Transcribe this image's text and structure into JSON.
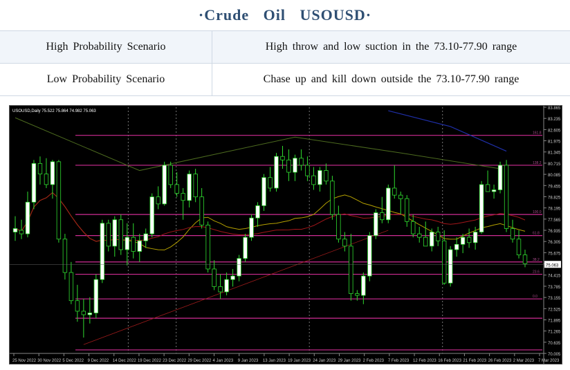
{
  "header": {
    "title": "·Crude Oil USOUSD·"
  },
  "scenarios": [
    {
      "label": "High Probability Scenario",
      "value": "High throw and low suction in the 73.10-77.90 range"
    },
    {
      "label": "Low Probability Scenario",
      "value": "Chase up and kill down outside the 73.10-77.90 range"
    }
  ],
  "chart_data": {
    "type": "candlestick",
    "info_line": "USOUSD,Daily 75.522 75.864 74.982 75.063",
    "price_ticks": [
      "83.865",
      "83.235",
      "82.605",
      "81.975",
      "81.345",
      "80.715",
      "80.085",
      "79.455",
      "78.825",
      "78.195",
      "77.565",
      "76.935",
      "76.305",
      "75.675",
      "75.045",
      "74.415",
      "73.785",
      "73.155",
      "72.525",
      "71.895",
      "71.265",
      "70.635",
      "70.005"
    ],
    "date_ticks": [
      "25 Nov 2022",
      "30 Nov 2022",
      "5 Dec 2022",
      "9 Dec 2022",
      "14 Dec 2022",
      "19 Dec 2022",
      "23 Dec 2022",
      "29 Dec 2022",
      "4 Jan 2023",
      "9 Jan 2023",
      "13 Jan 2023",
      "19 Jan 2023",
      "24 Jan 2023",
      "29 Jan 2023",
      "2 Feb 2023",
      "7 Feb 2023",
      "12 Feb 2023",
      "16 Feb 2023",
      "21 Feb 2023",
      "26 Feb 2023",
      "2 Mar 2023",
      "7 Mar 2023"
    ],
    "ylim": [
      70.0,
      84.0
    ],
    "current_price": "75.063",
    "level_labels": [
      "161.8",
      "138.2",
      "100.0",
      "61.8",
      "38.2",
      "23.6",
      "0.0"
    ],
    "levels": [
      82.4,
      80.7,
      77.9,
      76.7,
      75.2,
      74.5,
      73.1,
      72.0,
      70.2
    ],
    "candles": [
      [
        76.9,
        77.8,
        76.4,
        77.1
      ],
      [
        77.0,
        77.6,
        76.5,
        76.8
      ],
      [
        76.8,
        79.2,
        76.6,
        78.6
      ],
      [
        78.6,
        81.0,
        78.2,
        80.8
      ],
      [
        80.8,
        81.2,
        79.6,
        80.2
      ],
      [
        80.2,
        81.1,
        79.4,
        79.6
      ],
      [
        79.6,
        81.0,
        78.8,
        80.9
      ],
      [
        80.9,
        81.0,
        76.3,
        76.5
      ],
      [
        76.5,
        76.8,
        74.2,
        74.6
      ],
      [
        74.6,
        75.2,
        72.8,
        73.0
      ],
      [
        73.0,
        73.9,
        71.8,
        72.4
      ],
      [
        72.4,
        73.1,
        70.9,
        72.2
      ],
      [
        72.2,
        73.2,
        71.7,
        72.3
      ],
      [
        72.3,
        74.5,
        72.0,
        74.2
      ],
      [
        74.2,
        77.6,
        74.0,
        77.4
      ],
      [
        77.4,
        77.6,
        75.8,
        76.1
      ],
      [
        76.1,
        77.8,
        75.5,
        77.6
      ],
      [
        77.6,
        77.9,
        75.6,
        75.9
      ],
      [
        75.9,
        77.4,
        75.0,
        76.6
      ],
      [
        76.6,
        77.4,
        75.4,
        75.8
      ],
      [
        75.8,
        76.8,
        75.2,
        76.4
      ],
      [
        76.4,
        77.1,
        76.0,
        76.8
      ],
      [
        76.8,
        79.1,
        76.6,
        78.9
      ],
      [
        78.9,
        79.5,
        78.2,
        78.5
      ],
      [
        78.5,
        80.9,
        78.4,
        80.7
      ],
      [
        80.7,
        80.9,
        79.4,
        79.6
      ],
      [
        79.6,
        80.3,
        78.9,
        79.1
      ],
      [
        79.1,
        79.4,
        77.6,
        78.7
      ],
      [
        78.7,
        80.4,
        78.3,
        80.2
      ],
      [
        80.2,
        80.5,
        78.6,
        78.9
      ],
      [
        78.9,
        79.4,
        77.1,
        77.3
      ],
      [
        77.3,
        77.5,
        74.6,
        74.8
      ],
      [
        74.8,
        75.3,
        73.6,
        73.8
      ],
      [
        73.8,
        74.5,
        73.1,
        73.5
      ],
      [
        73.5,
        74.6,
        73.3,
        74.2
      ],
      [
        74.2,
        74.8,
        73.8,
        74.4
      ],
      [
        74.4,
        75.6,
        74.1,
        75.4
      ],
      [
        75.4,
        76.8,
        75.2,
        76.6
      ],
      [
        76.6,
        77.9,
        76.4,
        77.7
      ],
      [
        77.7,
        78.6,
        77.2,
        78.4
      ],
      [
        78.4,
        80.2,
        78.1,
        80.0
      ],
      [
        80.0,
        80.6,
        79.2,
        79.4
      ],
      [
        79.4,
        81.4,
        79.2,
        81.2
      ],
      [
        81.2,
        81.8,
        80.5,
        81.0
      ],
      [
        81.0,
        81.6,
        79.8,
        80.3
      ],
      [
        80.3,
        81.3,
        79.8,
        81.1
      ],
      [
        81.1,
        81.6,
        80.4,
        80.7
      ],
      [
        80.7,
        81.2,
        79.8,
        80.1
      ],
      [
        80.1,
        80.6,
        79.3,
        79.6
      ],
      [
        79.6,
        80.6,
        79.2,
        80.4
      ],
      [
        80.4,
        80.8,
        79.6,
        79.8
      ],
      [
        79.8,
        80.1,
        77.6,
        77.9
      ],
      [
        77.9,
        78.4,
        76.3,
        76.5
      ],
      [
        76.5,
        76.9,
        75.8,
        76.1
      ],
      [
        76.1,
        76.8,
        73.0,
        73.4
      ],
      [
        73.4,
        73.6,
        73.0,
        73.3
      ],
      [
        73.3,
        74.6,
        72.8,
        74.4
      ],
      [
        74.4,
        76.9,
        74.1,
        76.7
      ],
      [
        76.7,
        78.2,
        76.5,
        78.0
      ],
      [
        78.0,
        78.9,
        77.4,
        77.6
      ],
      [
        77.6,
        79.6,
        77.4,
        79.4
      ],
      [
        79.4,
        80.7,
        78.8,
        79.0
      ],
      [
        79.0,
        79.2,
        77.9,
        78.8
      ],
      [
        78.8,
        79.0,
        77.2,
        77.5
      ],
      [
        77.5,
        77.9,
        76.6,
        76.8
      ],
      [
        76.8,
        77.2,
        76.3,
        76.6
      ],
      [
        76.6,
        77.5,
        76.2,
        76.1
      ],
      [
        76.1,
        77.1,
        75.8,
        76.9
      ],
      [
        76.9,
        77.2,
        76.1,
        76.4
      ],
      [
        76.4,
        77.0,
        73.9,
        74.0
      ],
      [
        74.0,
        76.1,
        73.8,
        75.9
      ],
      [
        75.9,
        76.6,
        75.5,
        76.2
      ],
      [
        76.2,
        76.8,
        75.7,
        76.6
      ],
      [
        76.6,
        77.1,
        76.0,
        76.3
      ],
      [
        76.3,
        77.2,
        75.9,
        76.9
      ],
      [
        76.9,
        79.8,
        76.8,
        79.6
      ],
      [
        79.6,
        80.4,
        79.2,
        79.2
      ],
      [
        79.2,
        79.6,
        78.8,
        79.3
      ],
      [
        79.3,
        80.9,
        79.1,
        80.7
      ],
      [
        80.7,
        81.0,
        76.9,
        77.1
      ],
      [
        77.1,
        77.6,
        76.3,
        76.5
      ],
      [
        76.5,
        77.0,
        75.4,
        75.6
      ],
      [
        75.6,
        75.9,
        74.9,
        75.1
      ]
    ]
  }
}
